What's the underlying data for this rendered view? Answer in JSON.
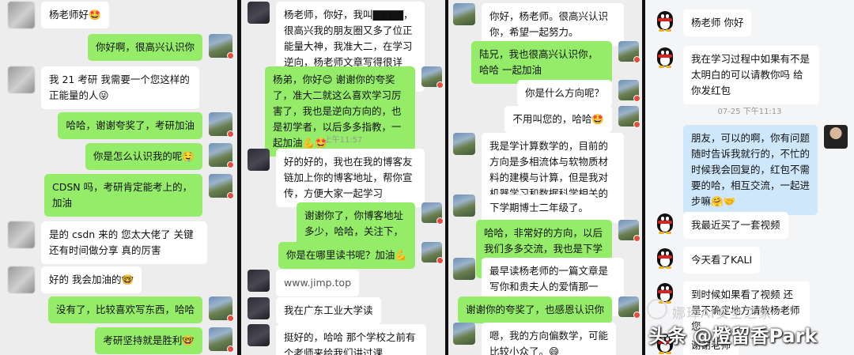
{
  "panel1": {
    "messages": [
      {
        "side": "left",
        "text": "杨老师好🤩"
      },
      {
        "side": "right",
        "text": "你好啊，很高兴认识你"
      },
      {
        "side": "left",
        "text": "我 21 考研  我需要一个您这样的正能量的人😜"
      },
      {
        "side": "right",
        "text": "哈哈，谢谢夸奖了，考研加油"
      },
      {
        "side": "right",
        "text": "你是怎么认识我的呢🤤"
      },
      {
        "side": "left",
        "text": "CDSN 吗，考研肯定能考上的，加油"
      },
      {
        "side": "left",
        "text": "是的 csdn 来的  您太大佬了  关键还有时间做分享  真的厉害"
      },
      {
        "side": "left",
        "text": "好的  我会加油的🤓"
      },
      {
        "side": "right",
        "text": "没有了，比较喜欢写东西，哈哈"
      },
      {
        "side": "right",
        "text": "考研坚持就是胜利🤓"
      }
    ]
  },
  "panel2": {
    "messages": [
      {
        "side": "left",
        "text": "杨老师，你好，我叫▇▇▇▇，很高兴我的朋友圈又多了位正能量大神，我准大二，在学习逆向，杨老师文章写得很详细，很喜欢🌹"
      },
      {
        "side": "right",
        "text": "杨弟，你好😊 谢谢你的夸奖了，准大二就这么喜欢学习厉害了，我也是逆向方向的，也是初学者，以后多多指教，一起加油💪🤩"
      },
      {
        "side": "left",
        "text": "好的好的，我也在我的博客友链加上你的博客地址，帮你宣传，方便大家一起学习"
      },
      {
        "side": "right",
        "text": "谢谢你了，你博客地址多少，哈哈，关注下，相互学习"
      },
      {
        "side": "right",
        "text": "你是在哪里读书呢？加油💪"
      },
      {
        "side": "left",
        "text": "www.jimp.top"
      },
      {
        "side": "left",
        "text": "我在广东工业大学读"
      },
      {
        "side": "left",
        "text": "挺好的，哈哈 那个学校之前有个老师来给我们讲过课"
      }
    ],
    "time": "上午11:57"
  },
  "panel3": {
    "messages": [
      {
        "side": "left",
        "text": "你好，杨老师。很高兴认识你，希望一起努力。"
      },
      {
        "side": "right",
        "text": "陆兄，我也很高兴认识你，哈哈 一起加油"
      },
      {
        "side": "right",
        "text": "你是什么方向呢？"
      },
      {
        "side": "right",
        "text": "不用叫您的，哈哈🤩"
      },
      {
        "side": "left",
        "text": "我是学计算数学的，目前的方向是多相流体与软物质材料的建模与计算，但是我对机器学习和数据科学相关的东西非常感兴趣。"
      },
      {
        "side": "left",
        "text": "下学期博士二年级了。"
      },
      {
        "side": "right",
        "text": "哈哈，非常好的方向，以后我们多多交流，我也是下学期博二🤝😄"
      },
      {
        "side": "left",
        "text": "最早读杨老师的一篇文章是写你和贵夫人的爱情那一篇，写的真好。"
      },
      {
        "side": "right",
        "text": "谢谢你的夸奖了，也感恩认识你"
      },
      {
        "side": "left",
        "text": "嗯，我的方向偏数学，可能比较小众了。😄"
      }
    ]
  },
  "panel4": {
    "messages": [
      {
        "side": "left",
        "text": "杨老师 你好"
      },
      {
        "side": "left",
        "text": "我在学习过程中如果有不是太明白的可以请教你吗  给你发红包"
      },
      {
        "side": "right",
        "text": "朋友，可以的啊，你有问题随时告诉我就行的，不忙的时候我会回复的，红包不需要的哈，相互交流，一起进步嘛🤗🤝"
      },
      {
        "side": "left",
        "text": "我最近买了一套视频"
      },
      {
        "side": "left",
        "text": "今天看了KALI"
      },
      {
        "side": "left",
        "text": "到时候如果看了视频 还是不确定地方请教杨老师您"
      },
      {
        "side": "left",
        "text": "谢谢老师"
      }
    ],
    "time": "07-25 下午11:13"
  },
  "watermark": {
    "line1": "娜璋AI安全之家",
    "line2": "头条 @橙留香Park"
  },
  "colors": {
    "green_bubble": "#95ec69",
    "blue_bubble": "#cfe7fb",
    "white_bubble": "#ffffff",
    "chat_bg": "#ededed"
  }
}
